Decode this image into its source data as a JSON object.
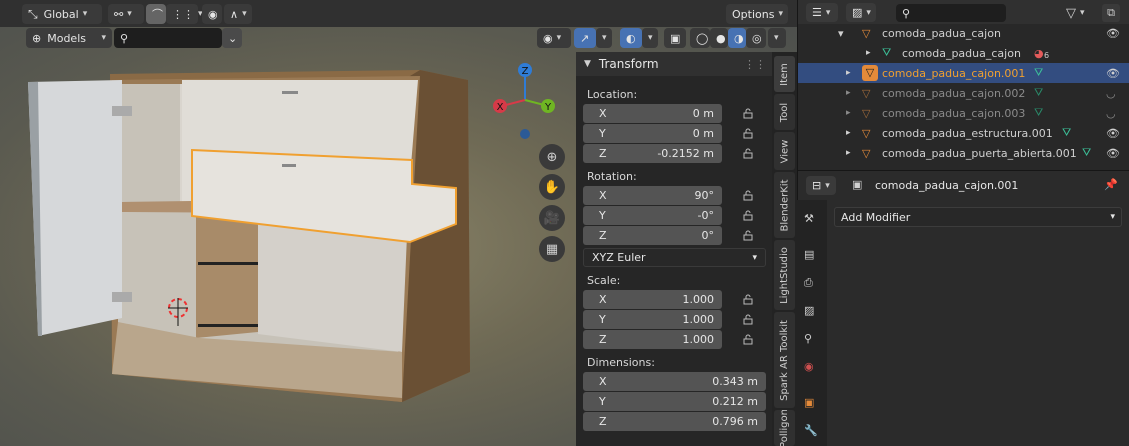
{
  "viewport": {
    "orientation_label": "Global",
    "options_label": "Options",
    "collection_label": "Models",
    "search_placeholder": "",
    "gizmo": {
      "x": "X",
      "y": "Y",
      "z": "Z"
    }
  },
  "npanel": {
    "section_title": "Transform",
    "location_label": "Location:",
    "location": [
      {
        "axis": "X",
        "value": "0 m"
      },
      {
        "axis": "Y",
        "value": "0 m"
      },
      {
        "axis": "Z",
        "value": "-0.2152 m"
      }
    ],
    "rotation_label": "Rotation:",
    "rotation": [
      {
        "axis": "X",
        "value": "90°"
      },
      {
        "axis": "Y",
        "value": "-0°"
      },
      {
        "axis": "Z",
        "value": "0°"
      }
    ],
    "rotation_mode": "XYZ Euler",
    "scale_label": "Scale:",
    "scale": [
      {
        "axis": "X",
        "value": "1.000"
      },
      {
        "axis": "Y",
        "value": "1.000"
      },
      {
        "axis": "Z",
        "value": "1.000"
      }
    ],
    "dimensions_label": "Dimensions:",
    "dimensions": [
      {
        "axis": "X",
        "value": "0.343 m"
      },
      {
        "axis": "Y",
        "value": "0.212 m"
      },
      {
        "axis": "Z",
        "value": "0.796 m"
      }
    ],
    "tabs": [
      "Item",
      "Tool",
      "View",
      "BlenderKit",
      "LightStudio",
      "Spark AR Toolkit",
      "Polligon"
    ]
  },
  "outliner": {
    "rows": [
      {
        "name": "comoda_padua_cajon",
        "state": "normal"
      },
      {
        "name": "comoda_padua_cajon",
        "state": "mesh"
      },
      {
        "name": "comoda_padua_cajon.001",
        "state": "selected"
      },
      {
        "name": "comoda_padua_cajon.002",
        "state": "hidden"
      },
      {
        "name": "comoda_padua_cajon.003",
        "state": "hidden"
      },
      {
        "name": "comoda_padua_estructura.001",
        "state": "normal"
      },
      {
        "name": "comoda_padua_puerta_abierta.001",
        "state": "normal"
      }
    ],
    "material_count": "6"
  },
  "properties": {
    "object_name": "comoda_padua_cajon.001",
    "add_modifier_label": "Add Modifier"
  },
  "colors": {
    "accent": "#4772b3",
    "selected_row": "#334d80",
    "object_orange": "#e38a3a",
    "mesh_green": "#3cc29a"
  }
}
